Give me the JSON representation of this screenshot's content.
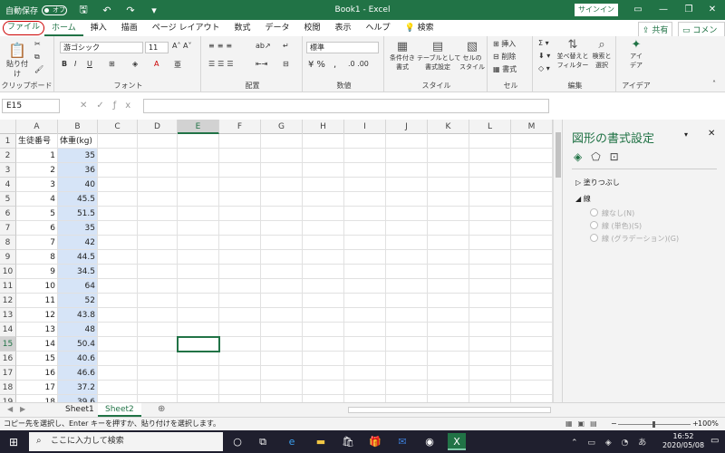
{
  "window": {
    "autosave_label": "自動保存",
    "autosave_state": "オフ",
    "title": "Book1 - Excel",
    "signin": "サインイン"
  },
  "tabs": [
    "ファイル",
    "ホーム",
    "挿入",
    "描画",
    "ページ レイアウト",
    "数式",
    "データ",
    "校閲",
    "表示",
    "ヘルプ",
    "検索"
  ],
  "share": "共有",
  "comment": "コメント",
  "ribbon": {
    "clipboard": {
      "label": "クリップボード",
      "paste": "貼り付け"
    },
    "font": {
      "label": "フォント",
      "name": "游ゴシック",
      "size": "11"
    },
    "alignment": {
      "label": "配置"
    },
    "number": {
      "label": "数値",
      "format": "標準"
    },
    "styles": {
      "label": "スタイル",
      "conditional": "条件付き\n書式",
      "table": "テーブルとして\n書式設定",
      "cell": "セルの\nスタイル"
    },
    "cells": {
      "label": "セル",
      "insert": "挿入",
      "delete": "削除",
      "format": "書式"
    },
    "editing": {
      "label": "編集",
      "sort": "並べ替えと\nフィルター",
      "find": "検索と\n選択"
    },
    "ideas": {
      "label": "アイデア",
      "ideas": "アイ\nデア"
    }
  },
  "name_box": "E15",
  "columns": [
    "A",
    "B",
    "C",
    "D",
    "E",
    "F",
    "G",
    "H",
    "I",
    "J",
    "K",
    "L",
    "M"
  ],
  "rows": [
    [
      "生徒番号",
      "体重(kg)"
    ],
    [
      "1",
      "35"
    ],
    [
      "2",
      "36"
    ],
    [
      "3",
      "40"
    ],
    [
      "4",
      "45.5"
    ],
    [
      "5",
      "51.5"
    ],
    [
      "6",
      "35"
    ],
    [
      "7",
      "42"
    ],
    [
      "8",
      "44.5"
    ],
    [
      "9",
      "34.5"
    ],
    [
      "10",
      "64"
    ],
    [
      "11",
      "52"
    ],
    [
      "12",
      "43.8"
    ],
    [
      "13",
      "48"
    ],
    [
      "14",
      "50.4"
    ],
    [
      "15",
      "40.6"
    ],
    [
      "16",
      "46.6"
    ],
    [
      "17",
      "37.2"
    ],
    [
      "18",
      "39.6"
    ]
  ],
  "pane": {
    "title": "図形の書式設定",
    "fill": "塗りつぶし",
    "line": "線",
    "opt_none": "線なし(N)",
    "opt_solid": "線 (単色)(S)",
    "opt_grad": "線 (グラデーション)(G)"
  },
  "sheets": [
    "Sheet1",
    "Sheet2"
  ],
  "status": {
    "message": "コピー先を選択し、Enter キーを押すか、貼り付けを選択します。",
    "zoom": "100%"
  },
  "taskbar": {
    "search_placeholder": "ここに入力して検索",
    "time": "16:52",
    "date": "2020/05/08"
  },
  "colors": {
    "accent": "#217346",
    "selection": "#d6e4f7"
  }
}
